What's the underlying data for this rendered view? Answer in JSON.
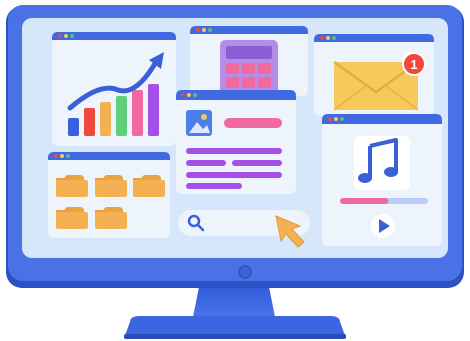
{
  "notification": {
    "count": "1"
  },
  "colors": {
    "frame": "#3b66e0",
    "frame_dark": "#2f4fc4",
    "screen": "#d6e7fb",
    "window_header": "#4169e1",
    "window_body": "#eef4fc",
    "badge": "#f2473c",
    "envelope": "#f6c95a",
    "folder": "#f4b153",
    "purple": "#a64ee8",
    "pink": "#f06aa0"
  },
  "icons": {
    "chart": "bar-chart-trend-icon",
    "calculator": "calculator-icon",
    "mail": "envelope-icon",
    "image": "image-icon",
    "music": "music-note-icon",
    "play": "play-icon",
    "search": "search-icon",
    "cursor": "hand-cursor-icon",
    "folder": "folder-icon"
  },
  "media": {
    "progress": 0.55
  }
}
